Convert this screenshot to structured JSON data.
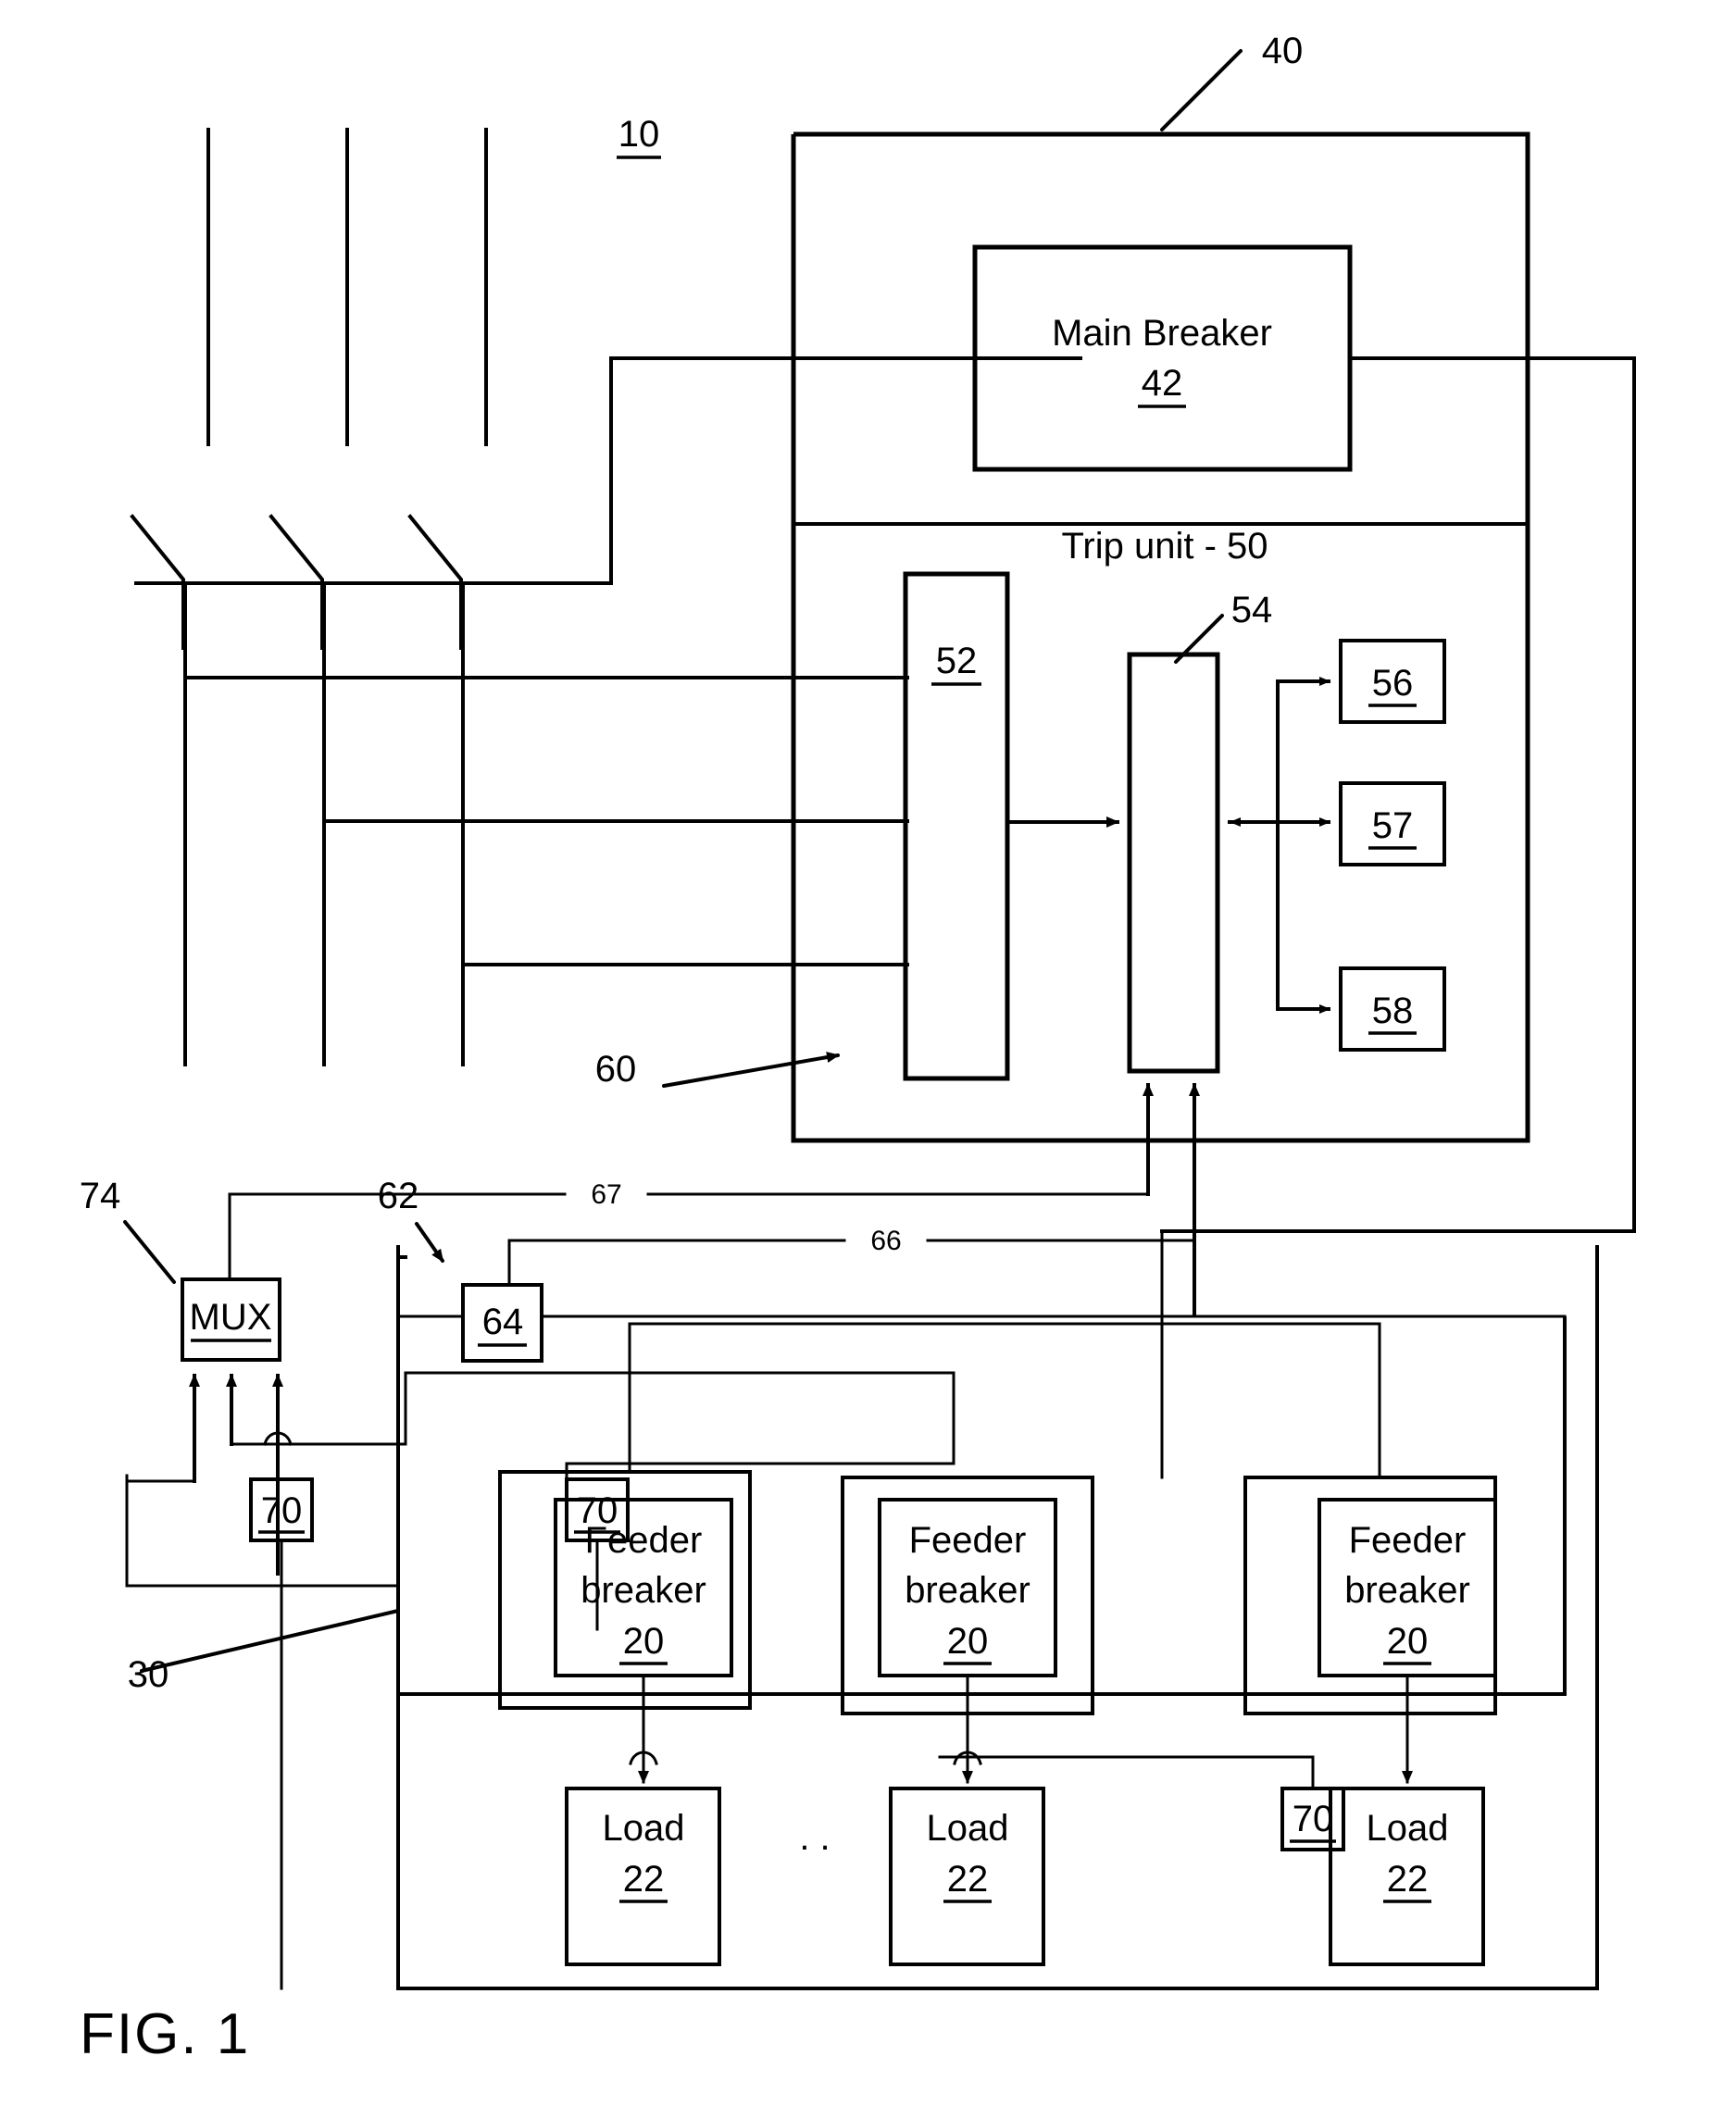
{
  "figure": {
    "caption": "FIG. 1",
    "system_ref": "10"
  },
  "labels": {
    "system": "10",
    "main_assembly": "40",
    "sensor_bus": "60",
    "network_62": "62",
    "line_66": "66",
    "line_67": "67",
    "panel_30": "30",
    "mux_ref": "74",
    "block54_ref": "54"
  },
  "blocks": {
    "main_breaker": {
      "title": "Main Breaker",
      "ref": "42"
    },
    "trip_unit": {
      "title": "Trip unit - 50"
    },
    "b52": {
      "ref": "52"
    },
    "b54": {
      "ref": "54"
    },
    "b56": {
      "ref": "56"
    },
    "b57": {
      "ref": "57"
    },
    "b58": {
      "ref": "58"
    },
    "b64": {
      "ref": "64"
    },
    "mux": {
      "ref": "MUX"
    },
    "sensor_70a": {
      "ref": "70"
    },
    "sensor_70b": {
      "ref": "70"
    },
    "sensor_70c": {
      "ref": "70"
    }
  },
  "feeders": [
    {
      "title_line1": "Feeder",
      "title_line2": "breaker",
      "ref": "20"
    },
    {
      "title_line1": "Feeder",
      "title_line2": "breaker",
      "ref": "20"
    },
    {
      "title_line1": "Feeder",
      "title_line2": "breaker",
      "ref": "20"
    }
  ],
  "loads": [
    {
      "title": "Load",
      "ref": "22"
    },
    {
      "title": "Load",
      "ref": "22"
    },
    {
      "title": "Load",
      "ref": "22"
    }
  ],
  "ellipsis": ". .",
  "colors": {
    "ink": "#000000",
    "paper": "#ffffff"
  }
}
